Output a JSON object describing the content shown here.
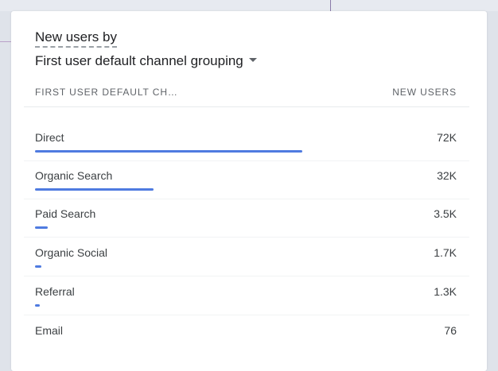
{
  "card": {
    "title_line1": "New users by",
    "title_line2": "First user default channel grouping"
  },
  "table": {
    "col_dimension": "FIRST USER DEFAULT CH…",
    "col_metric": "NEW USERS",
    "accent_color": "#4f7be0",
    "rows": [
      {
        "label": "Direct",
        "value": "72K",
        "share": 1.0
      },
      {
        "label": "Organic Search",
        "value": "32K",
        "share": 0.444
      },
      {
        "label": "Paid Search",
        "value": "3.5K",
        "share": 0.049
      },
      {
        "label": "Organic Social",
        "value": "1.7K",
        "share": 0.024
      },
      {
        "label": "Referral",
        "value": "1.3K",
        "share": 0.018
      },
      {
        "label": "Email",
        "value": "76",
        "share": 0.001
      }
    ]
  }
}
